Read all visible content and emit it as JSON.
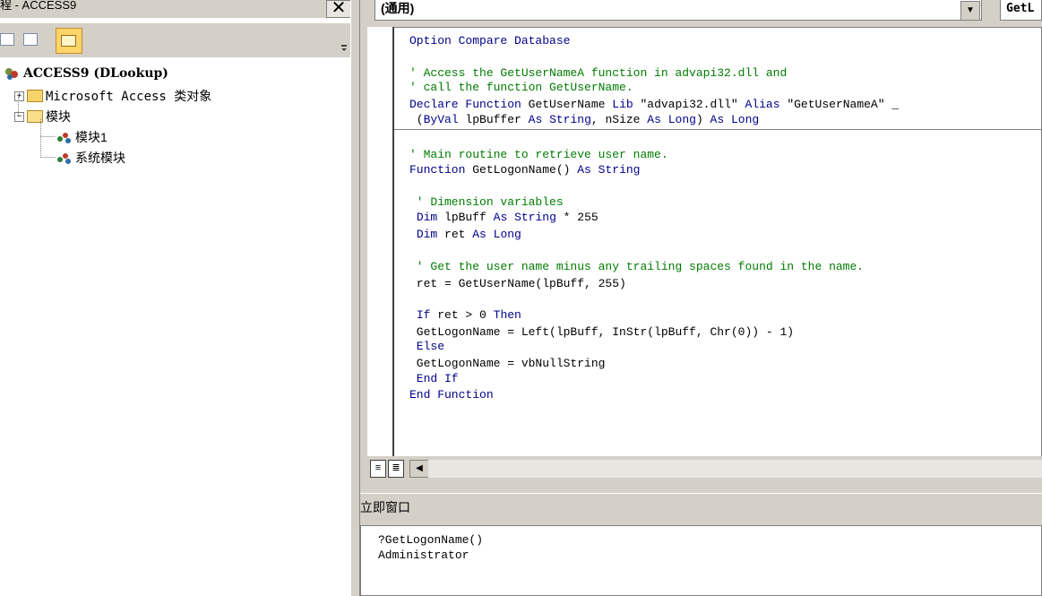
{
  "project_pane": {
    "title": "程 - ACCESS9",
    "close_label": "✕",
    "tree": {
      "root_label": "ACCESS9 (DLookup)",
      "class_objects_label": "Microsoft Access 类对象",
      "modules_label": "模块",
      "module1_label": "模块1",
      "module2_label": "系统模块",
      "expand_symbol": "+",
      "collapse_symbol": "−"
    }
  },
  "code_window": {
    "object_combo": "(通用)",
    "procedure_combo": "GetL",
    "combo_arrow": "▼",
    "view_buttons": [
      "≡",
      "≣"
    ],
    "scroll_left": "◀",
    "lines": [
      {
        "text": "Option Compare Database",
        "style": "kw"
      },
      {
        "text": "' Access the GetUserNameA function in advapi32.dll and",
        "style": "cm"
      },
      {
        "text": "' call the function GetUserName.",
        "style": "cm"
      },
      {
        "text": "Declare Function GetUserName Lib \"advapi32.dll\" Alias \"GetUserNameA\" _",
        "style": "mixed"
      },
      {
        "text": " (ByVal lpBuffer As String, nSize As Long) As Long",
        "style": "mixed"
      },
      {
        "text": "' Main routine to retrieve user name.",
        "style": "cm"
      },
      {
        "text": "Function GetLogonName() As String",
        "style": "mixed"
      },
      {
        "text": " ' Dimension variables",
        "style": "cm"
      },
      {
        "text": " Dim lpBuff As String * 255",
        "style": "mixed"
      },
      {
        "text": " Dim ret As Long",
        "style": "mixed"
      },
      {
        "text": " ' Get the user name minus any trailing spaces found in the name.",
        "style": "cm"
      },
      {
        "text": " ret = GetUserName(lpBuff, 255)",
        "style": "plain"
      },
      {
        "text": " If ret > 0 Then",
        "style": "mixed"
      },
      {
        "text": " GetLogonName = Left(lpBuff, InStr(lpBuff, Chr(0)) - 1)",
        "style": "plain"
      },
      {
        "text": " Else",
        "style": "kw"
      },
      {
        "text": " GetLogonName = vbNullString",
        "style": "plain"
      },
      {
        "text": " End If",
        "style": "kw"
      },
      {
        "text": "End Function",
        "style": "kw"
      }
    ]
  },
  "immediate_window": {
    "title": "立即窗口",
    "lines": [
      "?GetLogonName()",
      "Administrator"
    ]
  },
  "colors": {
    "keyword": "#00008b",
    "comment": "#007b00",
    "chrome": "#d4d0c8"
  }
}
